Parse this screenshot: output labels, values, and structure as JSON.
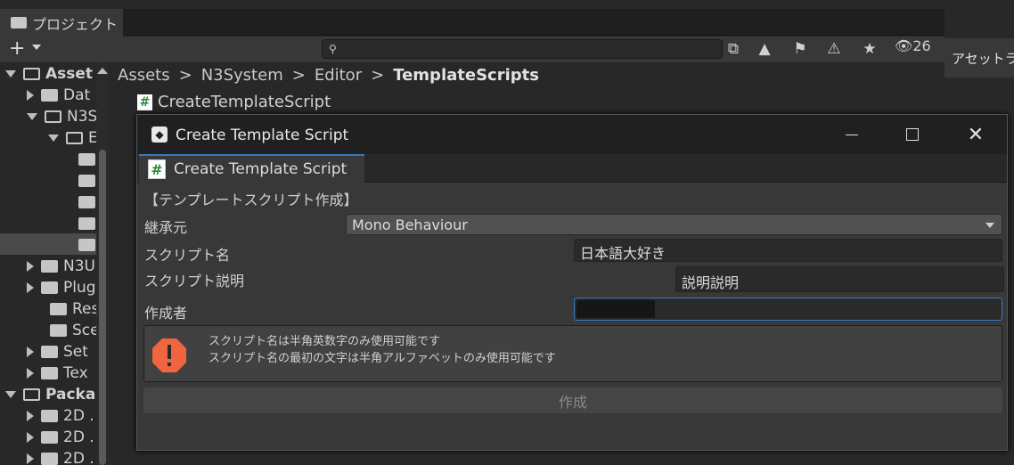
{
  "project": {
    "tab_label": "プロジェクト",
    "hidden_count": "26",
    "tree": [
      {
        "label": "Asset",
        "bold": true,
        "open": true
      },
      {
        "label": "Dat"
      },
      {
        "label": "N3S",
        "open": true
      },
      {
        "label": "E",
        "open": true
      },
      {
        "label": ""
      },
      {
        "label": ""
      },
      {
        "label": ""
      },
      {
        "label": ""
      },
      {
        "label": "",
        "selected": true
      },
      {
        "label": "N3U"
      },
      {
        "label": "Plug"
      },
      {
        "label": "Res"
      },
      {
        "label": "Sce"
      },
      {
        "label": "Set"
      },
      {
        "label": "Tex"
      },
      {
        "label": "Packa",
        "bold": true,
        "open": true
      },
      {
        "label": "2D ."
      },
      {
        "label": "2D ."
      },
      {
        "label": "2D ."
      }
    ],
    "breadcrumb": [
      "Assets",
      "N3System",
      "Editor",
      "TemplateScripts"
    ],
    "breadcrumb_sep": ">",
    "file_item": "CreateTemplateScript"
  },
  "right_panel": {
    "header": "アセットラ"
  },
  "dialog": {
    "title": "Create Template Script",
    "tab_label": "Create Template Script",
    "section_heading": "【テンプレートスクリプト作成】",
    "fields": {
      "base_class_label": "継承元",
      "base_class_value": "Mono Behaviour",
      "script_name_label": "スクリプト名",
      "script_name_value": "日本語大好き",
      "script_desc_label": "スクリプト説明",
      "script_desc_value": "説明説明",
      "author_label": "作成者",
      "author_value": ""
    },
    "warning": {
      "line1": "スクリプト名は半角英数字のみ使用可能です",
      "line2": "スクリプト名の最初の文字は半角アルファベットのみ使用可能です",
      "color": "#f06540"
    },
    "create_button": "作成"
  }
}
